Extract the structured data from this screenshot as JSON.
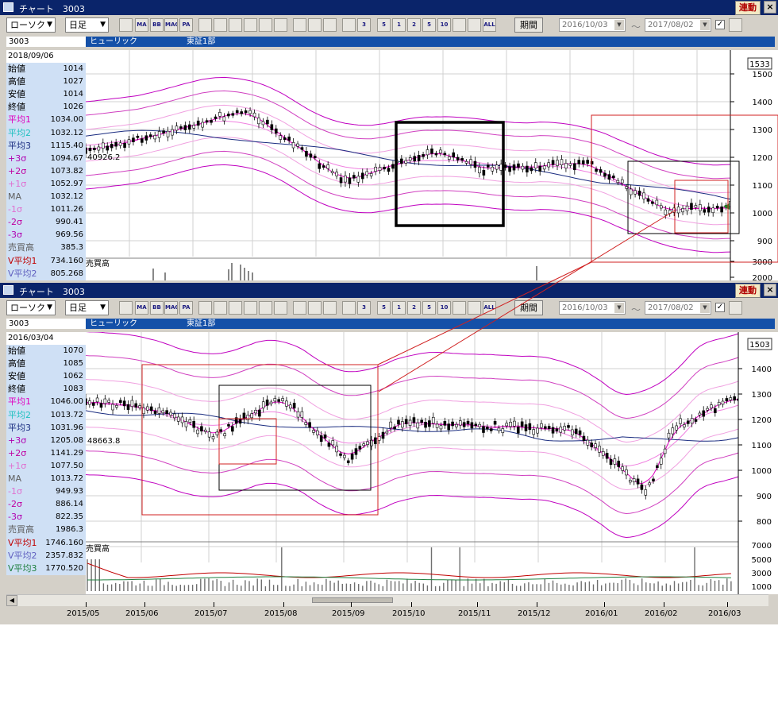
{
  "top": {
    "title": "チャート　3003",
    "link_label": "連動",
    "close_label": "×",
    "chart_type": "ローソク",
    "period": "日足",
    "kikan_label": "期間",
    "date_from": "2016/10/03",
    "date_to": "2017/08/02",
    "tilde": "〜",
    "code": "3003",
    "name": "ヒューリック",
    "market": "東証1部",
    "info": {
      "date": "2018/09/06",
      "rows": [
        {
          "label": "始値",
          "value": "1014",
          "color": "#000000"
        },
        {
          "label": "高値",
          "value": "1027",
          "color": "#000000"
        },
        {
          "label": "安値",
          "value": "1014",
          "color": "#000000"
        },
        {
          "label": "終値",
          "value": "1026",
          "color": "#000000"
        },
        {
          "label": "平均1",
          "value": "1034.00",
          "color": "#e000c0"
        },
        {
          "label": "平均2",
          "value": "1032.12",
          "color": "#20c0c0"
        },
        {
          "label": "平均3",
          "value": "1115.40",
          "color": "#1a2c80"
        },
        {
          "label": "+3σ",
          "value": "1094.67",
          "color": "#b000b0"
        },
        {
          "label": "+2σ",
          "value": "1073.82",
          "color": "#c000a0"
        },
        {
          "label": "+1σ",
          "value": "1052.97",
          "color": "#e070d0"
        },
        {
          "label": "MA",
          "value": "1032.12",
          "color": "#606060"
        },
        {
          "label": "-1σ",
          "value": "1011.26",
          "color": "#e070d0"
        },
        {
          "label": "-2σ",
          "value": "990.41",
          "color": "#c000a0"
        },
        {
          "label": "-3σ",
          "value": "969.56",
          "color": "#b000b0"
        },
        {
          "label": "売買高",
          "value": "385.3",
          "color": "#606060"
        },
        {
          "label": "V平均1",
          "value": "734.160",
          "color": "#c00000"
        },
        {
          "label": "V平均2",
          "value": "805.268",
          "color": "#6060c0"
        }
      ]
    },
    "price_tag": "1533",
    "yticks": [
      "1500",
      "1400",
      "1300",
      "1200",
      "1100",
      "1000",
      "900",
      "3000",
      "2000"
    ],
    "point_label": "40926.2",
    "vol_label": "売買高"
  },
  "bottom": {
    "title": "チャート　3003",
    "link_label": "連動",
    "close_label": "×",
    "chart_type": "ローソク",
    "period": "日足",
    "kikan_label": "期間",
    "date_from": "2016/10/03",
    "date_to": "2017/08/02",
    "tilde": "〜",
    "code": "3003",
    "name": "ヒューリック",
    "market": "東証1部",
    "info": {
      "date": "2016/03/04",
      "rows": [
        {
          "label": "始値",
          "value": "1070",
          "color": "#000000"
        },
        {
          "label": "高値",
          "value": "1085",
          "color": "#000000"
        },
        {
          "label": "安値",
          "value": "1062",
          "color": "#000000"
        },
        {
          "label": "終値",
          "value": "1083",
          "color": "#000000"
        },
        {
          "label": "平均1",
          "value": "1046.00",
          "color": "#e000c0"
        },
        {
          "label": "平均2",
          "value": "1013.72",
          "color": "#20c0c0"
        },
        {
          "label": "平均3",
          "value": "1031.96",
          "color": "#1a2c80"
        },
        {
          "label": "+3σ",
          "value": "1205.08",
          "color": "#b000b0"
        },
        {
          "label": "+2σ",
          "value": "1141.29",
          "color": "#c000a0"
        },
        {
          "label": "+1σ",
          "value": "1077.50",
          "color": "#e070d0"
        },
        {
          "label": "MA",
          "value": "1013.72",
          "color": "#606060"
        },
        {
          "label": "-1σ",
          "value": "949.93",
          "color": "#e070d0"
        },
        {
          "label": "-2σ",
          "value": "886.14",
          "color": "#c000a0"
        },
        {
          "label": "-3σ",
          "value": "822.35",
          "color": "#b000b0"
        },
        {
          "label": "売買高",
          "value": "1986.3",
          "color": "#606060"
        },
        {
          "label": "V平均1",
          "value": "1746.160",
          "color": "#c00000"
        },
        {
          "label": "V平均2",
          "value": "2357.832",
          "color": "#6060c0"
        },
        {
          "label": "V平均3",
          "value": "1770.520",
          "color": "#208040"
        }
      ]
    },
    "price_tag": "1503",
    "yticks": [
      "1400",
      "1300",
      "1200",
      "1100",
      "1000",
      "900",
      "800"
    ],
    "vticks": [
      "7000",
      "5000",
      "3000",
      "1000"
    ],
    "point_label": "48663.8",
    "vol_label": "売買高",
    "xticks": [
      "2015/05",
      "2015/06",
      "2015/07",
      "2015/08",
      "2015/09",
      "2015/10",
      "2015/11",
      "2015/12",
      "2016/01",
      "2016/02",
      "2016/03"
    ]
  },
  "toolbar_icons": [
    "tool-icon",
    "ma-icon",
    "bb-icon",
    "macd-icon",
    "pa-icon",
    "line-tool-icon",
    "wave-tool-icon",
    "zoom-icon",
    "calc-icon",
    "grid-icon",
    "pen-icon",
    "cursor-icon",
    "eraser-icon",
    "bulb-icon",
    "fib-icon",
    "3m-icon",
    "6m-icon",
    "1y-icon",
    "2y-icon",
    "5y-icon",
    "10y-icon",
    "all-icon-a",
    "all-icon-b",
    "all-icon"
  ],
  "toolbar_texts": [
    "",
    "MA",
    "BB",
    "MAC",
    "PA",
    "",
    "",
    "",
    "",
    "",
    "",
    "",
    "",
    "",
    "",
    "3",
    "5",
    "1",
    "2",
    "5",
    "10",
    "",
    "",
    "ALL"
  ]
}
